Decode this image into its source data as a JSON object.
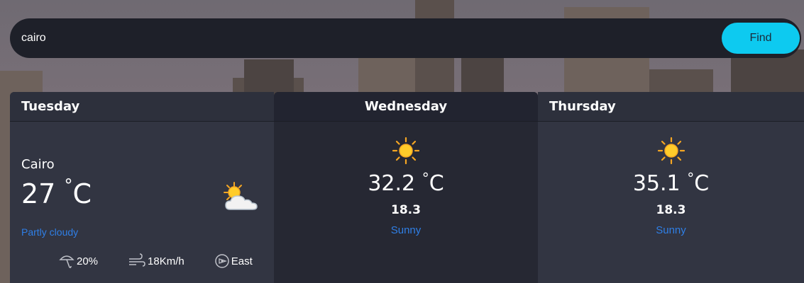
{
  "search": {
    "value": "cairo",
    "button_label": "Find"
  },
  "colors": {
    "accent": "#0dcaf0",
    "condition_text": "#2f7fe6"
  },
  "today": {
    "day": "Tuesday",
    "city": "Cairo",
    "temp": "27",
    "deg_symbol": "°",
    "unit": "C",
    "condition": "Partly cloudy",
    "icon": "partly-cloudy-icon",
    "rain": "20%",
    "wind": "18Km/h",
    "direction": "East"
  },
  "forecast": [
    {
      "day": "Wednesday",
      "icon": "sun-icon",
      "temp": "32.2",
      "deg_symbol": "°",
      "unit": "C",
      "min": "18.3",
      "condition": "Sunny"
    },
    {
      "day": "Thursday",
      "icon": "sun-icon",
      "temp": "35.1",
      "deg_symbol": "°",
      "unit": "C",
      "min": "18.3",
      "condition": "Sunny"
    }
  ]
}
